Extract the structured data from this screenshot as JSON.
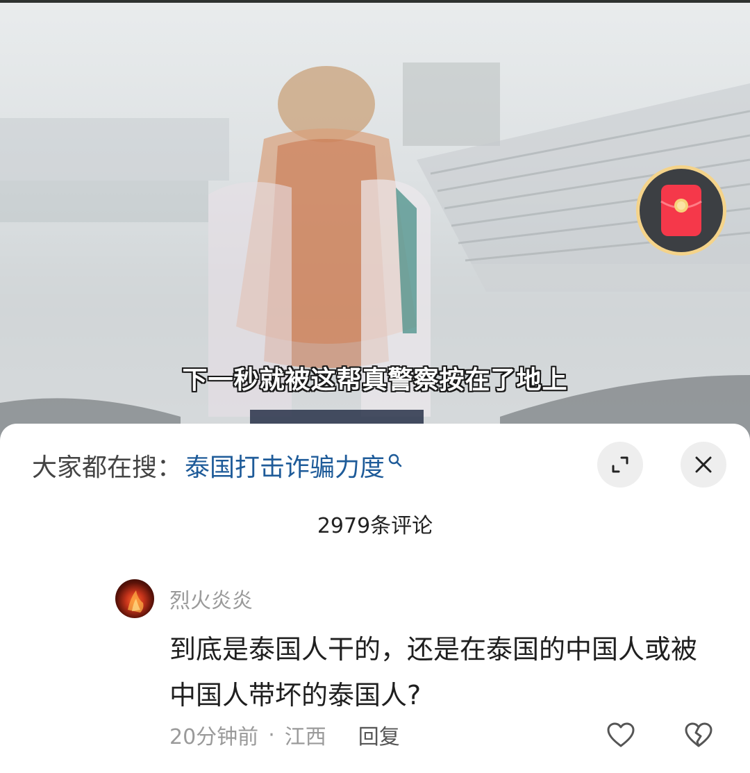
{
  "video": {
    "subtitle": "下一秒就被这帮真警察按在了地上",
    "redpacket_icon": "red-envelope-icon"
  },
  "sheet": {
    "search_prefix": "大家都在搜：",
    "search_term": "泰国打击诈骗力度",
    "search_icon": "search-icon",
    "expand_icon": "expand-icon",
    "close_icon": "close-icon",
    "comment_count": "2979条评论"
  },
  "comment": {
    "username": "烈火炎炎",
    "text": "到底是泰国人干的，还是在泰国的中国人或被中国人带坏的泰国人?",
    "time": "20分钟前",
    "separator": "·",
    "location": "江西",
    "reply_label": "回复",
    "like_icon": "heart-icon",
    "dislike_icon": "broken-heart-icon"
  },
  "colors": {
    "search_term": "#1e5b99",
    "redpacket": "#f5384a",
    "redpacket_ring": "#f4d38a"
  }
}
